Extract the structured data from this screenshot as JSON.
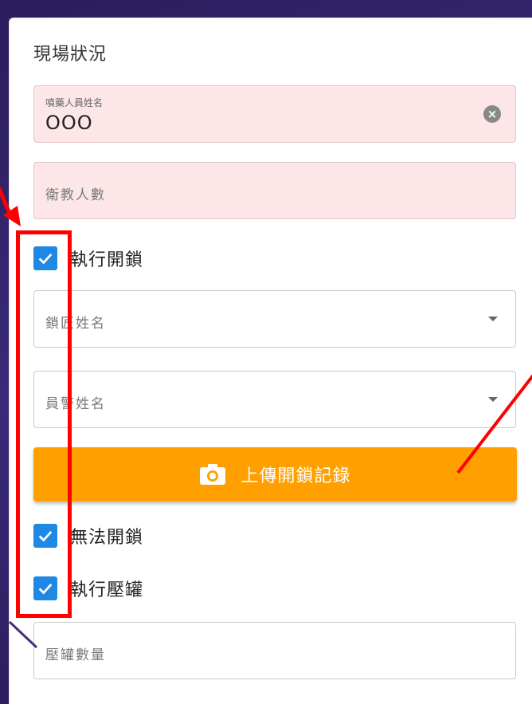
{
  "section": {
    "title": "現場狀況"
  },
  "fields": {
    "sprayer": {
      "label": "噴藥人員姓名",
      "value": "OOO"
    },
    "edu_count": {
      "placeholder": "衛教人數"
    },
    "locksmith": {
      "placeholder": "鎖匠姓名"
    },
    "officer": {
      "placeholder": "員警姓名"
    },
    "pressure_count": {
      "placeholder": "壓罐數量"
    }
  },
  "checkboxes": {
    "unlock": {
      "label": "執行開鎖",
      "checked": true
    },
    "cannot_unlock": {
      "label": "無法開鎖",
      "checked": true
    },
    "pressure": {
      "label": "執行壓罐",
      "checked": true
    }
  },
  "upload": {
    "label": "上傳開鎖記錄"
  },
  "colors": {
    "accent": "#1e88e5",
    "upload_button": "#ffa000",
    "required_field_bg": "#fce6e8",
    "annotation": "#ff0000",
    "background": "#2b1d5c"
  },
  "icons": {
    "clear": "close-circle-icon",
    "dropdown": "chevron-down-icon",
    "camera": "camera-icon",
    "check": "check-icon"
  }
}
